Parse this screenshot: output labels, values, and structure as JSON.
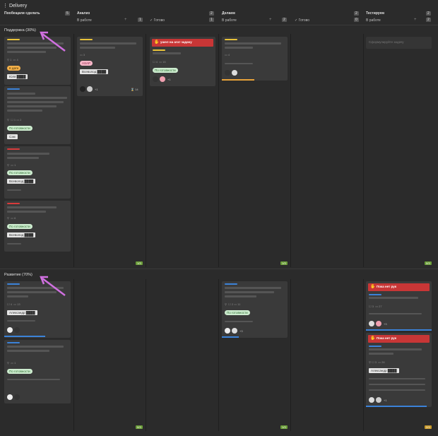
{
  "board": {
    "title": "Delivery",
    "columns": [
      {
        "name": "Пообещали сделать",
        "count": "5"
      },
      {
        "name": "Анализ",
        "count": "2",
        "in_work": "В работе",
        "in_work_count": "1",
        "done": "Готово",
        "done_count": "1"
      },
      {
        "name": "Делаем",
        "count": "2",
        "in_work": "В работе",
        "in_work_count": "2",
        "done": "Готово",
        "done_count": "0"
      },
      {
        "name": "Тестируем",
        "count": "2",
        "in_work": "В работе",
        "in_work_count": "2"
      }
    ],
    "plus": "+",
    "separator": "⋮"
  },
  "lanes": {
    "support": "Поддержка (30%)",
    "dev": "Развитие (70%)"
  },
  "cards": {
    "s1": {
      "tag1": "К дате",
      "tag2": "Юля ████",
      "m1": "1",
      "m2": "4"
    },
    "s2": {
      "tag": "По готовности",
      "person": "Сэм",
      "m1": "1",
      "m2": "2"
    },
    "s3": {
      "tag": "По готовности",
      "person": "Всеволод ████",
      "m2": "1"
    },
    "s4": {
      "tag": "По готовности",
      "person": "Всеволод ████",
      "m2": "6"
    },
    "a1": {
      "tag": "ASAP",
      "person": "Всеволод ████",
      "m2": "3",
      "plus": "+1",
      "timer": "14"
    },
    "w1": {
      "alert": "ушел на агат задачу",
      "tag": "По готовности",
      "m1": "4",
      "m2": "15",
      "plus": "+1"
    },
    "d1": {
      "m2": "4"
    },
    "t1": {
      "placeholder": "Сформулируйте задачу"
    },
    "v1": {
      "person": "Александр ████",
      "m1": "4",
      "m2": "13"
    },
    "v2": {
      "tag": "По готовности",
      "m2": "1"
    },
    "v3": {
      "tag": "По готовности",
      "m1": "2",
      "m2": "11",
      "plus": "+3"
    },
    "v4": {
      "alert": "Пока нет рук",
      "m1": "3",
      "m2": "27",
      "plus": "+3"
    },
    "v5": {
      "alert": "Пока нет рук",
      "person": "Александр ████",
      "m1": "3",
      "m2": "26",
      "plus": "+1"
    }
  },
  "wip": {
    "w1": "1/3",
    "w2": "1/3",
    "w3": "0/3",
    "w4": "0/3",
    "w5": "1/3",
    "w6": "2/3"
  },
  "colors": {
    "accent": "#6c9e3a",
    "alert": "#c83636",
    "arrow": "#d070e0"
  }
}
